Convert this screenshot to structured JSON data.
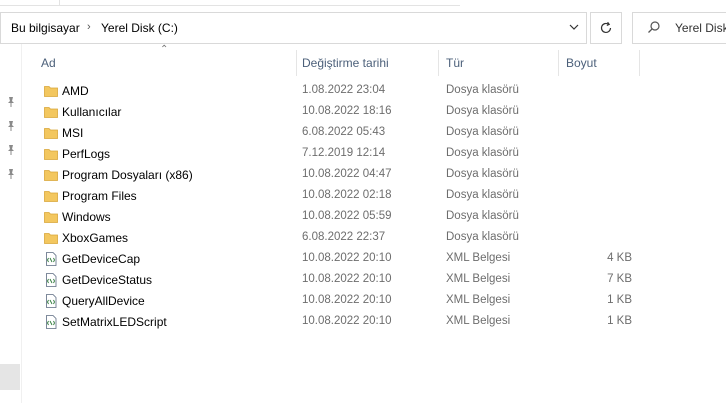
{
  "address": {
    "crumbs": [
      "Bu bilgisayar",
      "Yerel Disk (C:)"
    ]
  },
  "search": {
    "placeholder": "Yerel Disk"
  },
  "columns": {
    "name": "Ad",
    "date": "Değiştirme tarihi",
    "type": "Tür",
    "size": "Boyut"
  },
  "files": [
    {
      "name": "AMD",
      "date": "1.08.2022 23:04",
      "type": "Dosya klasörü",
      "size": "",
      "icon": "folder-icon"
    },
    {
      "name": "Kullanıcılar",
      "date": "10.08.2022 18:16",
      "type": "Dosya klasörü",
      "size": "",
      "icon": "folder-icon"
    },
    {
      "name": "MSI",
      "date": "6.08.2022 05:43",
      "type": "Dosya klasörü",
      "size": "",
      "icon": "folder-icon"
    },
    {
      "name": "PerfLogs",
      "date": "7.12.2019 12:14",
      "type": "Dosya klasörü",
      "size": "",
      "icon": "folder-icon"
    },
    {
      "name": "Program Dosyaları (x86)",
      "date": "10.08.2022 04:47",
      "type": "Dosya klasörü",
      "size": "",
      "icon": "folder-icon"
    },
    {
      "name": "Program Files",
      "date": "10.08.2022 02:18",
      "type": "Dosya klasörü",
      "size": "",
      "icon": "folder-icon"
    },
    {
      "name": "Windows",
      "date": "10.08.2022 05:59",
      "type": "Dosya klasörü",
      "size": "",
      "icon": "folder-icon"
    },
    {
      "name": "XboxGames",
      "date": "6.08.2022 22:37",
      "type": "Dosya klasörü",
      "size": "",
      "icon": "folder-icon"
    },
    {
      "name": "GetDeviceCap",
      "date": "10.08.2022 20:10",
      "type": "XML Belgesi",
      "size": "4 KB",
      "icon": "xml-file-icon"
    },
    {
      "name": "GetDeviceStatus",
      "date": "10.08.2022 20:10",
      "type": "XML Belgesi",
      "size": "7 KB",
      "icon": "xml-file-icon"
    },
    {
      "name": "QueryAllDevice",
      "date": "10.08.2022 20:10",
      "type": "XML Belgesi",
      "size": "1 KB",
      "icon": "xml-file-icon"
    },
    {
      "name": "SetMatrixLEDScript",
      "date": "10.08.2022 20:10",
      "type": "XML Belgesi",
      "size": "1 KB",
      "icon": "xml-file-icon"
    }
  ],
  "colors": {
    "folder": "#f3c75f",
    "folder_dark": "#d9a63a",
    "header_text": "#4c607a",
    "secondary_text": "#6d6d6d"
  }
}
